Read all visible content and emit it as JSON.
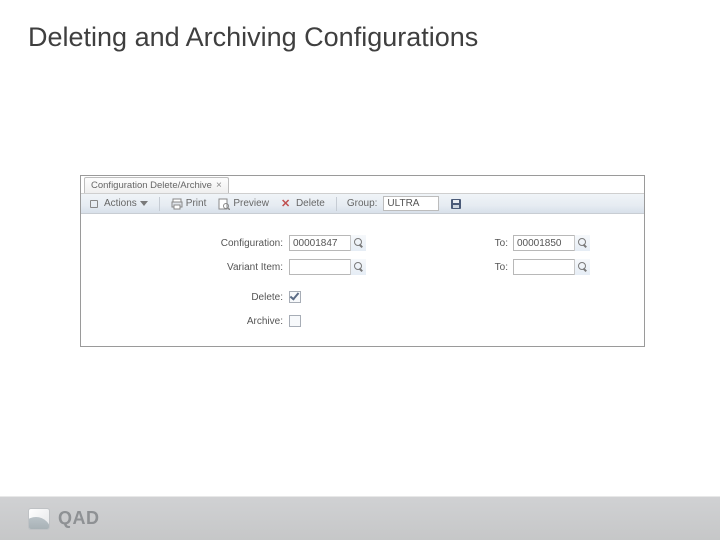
{
  "slide": {
    "title": "Deleting and Archiving Configurations"
  },
  "app": {
    "tab": {
      "label": "Configuration Delete/Archive"
    },
    "toolbar": {
      "actions": "Actions",
      "print": "Print",
      "preview": "Preview",
      "delete": "Delete",
      "group_label": "Group:",
      "group_value": "ULTRA"
    },
    "form": {
      "to_label": "To:",
      "configuration": {
        "label": "Configuration:",
        "from": "00001847",
        "to": "00001850"
      },
      "variant_item": {
        "label": "Variant Item:",
        "from": "",
        "to": ""
      },
      "delete": {
        "label": "Delete:",
        "checked": true
      },
      "archive": {
        "label": "Archive:",
        "checked": false
      }
    }
  },
  "footer": {
    "brand": "QAD"
  }
}
